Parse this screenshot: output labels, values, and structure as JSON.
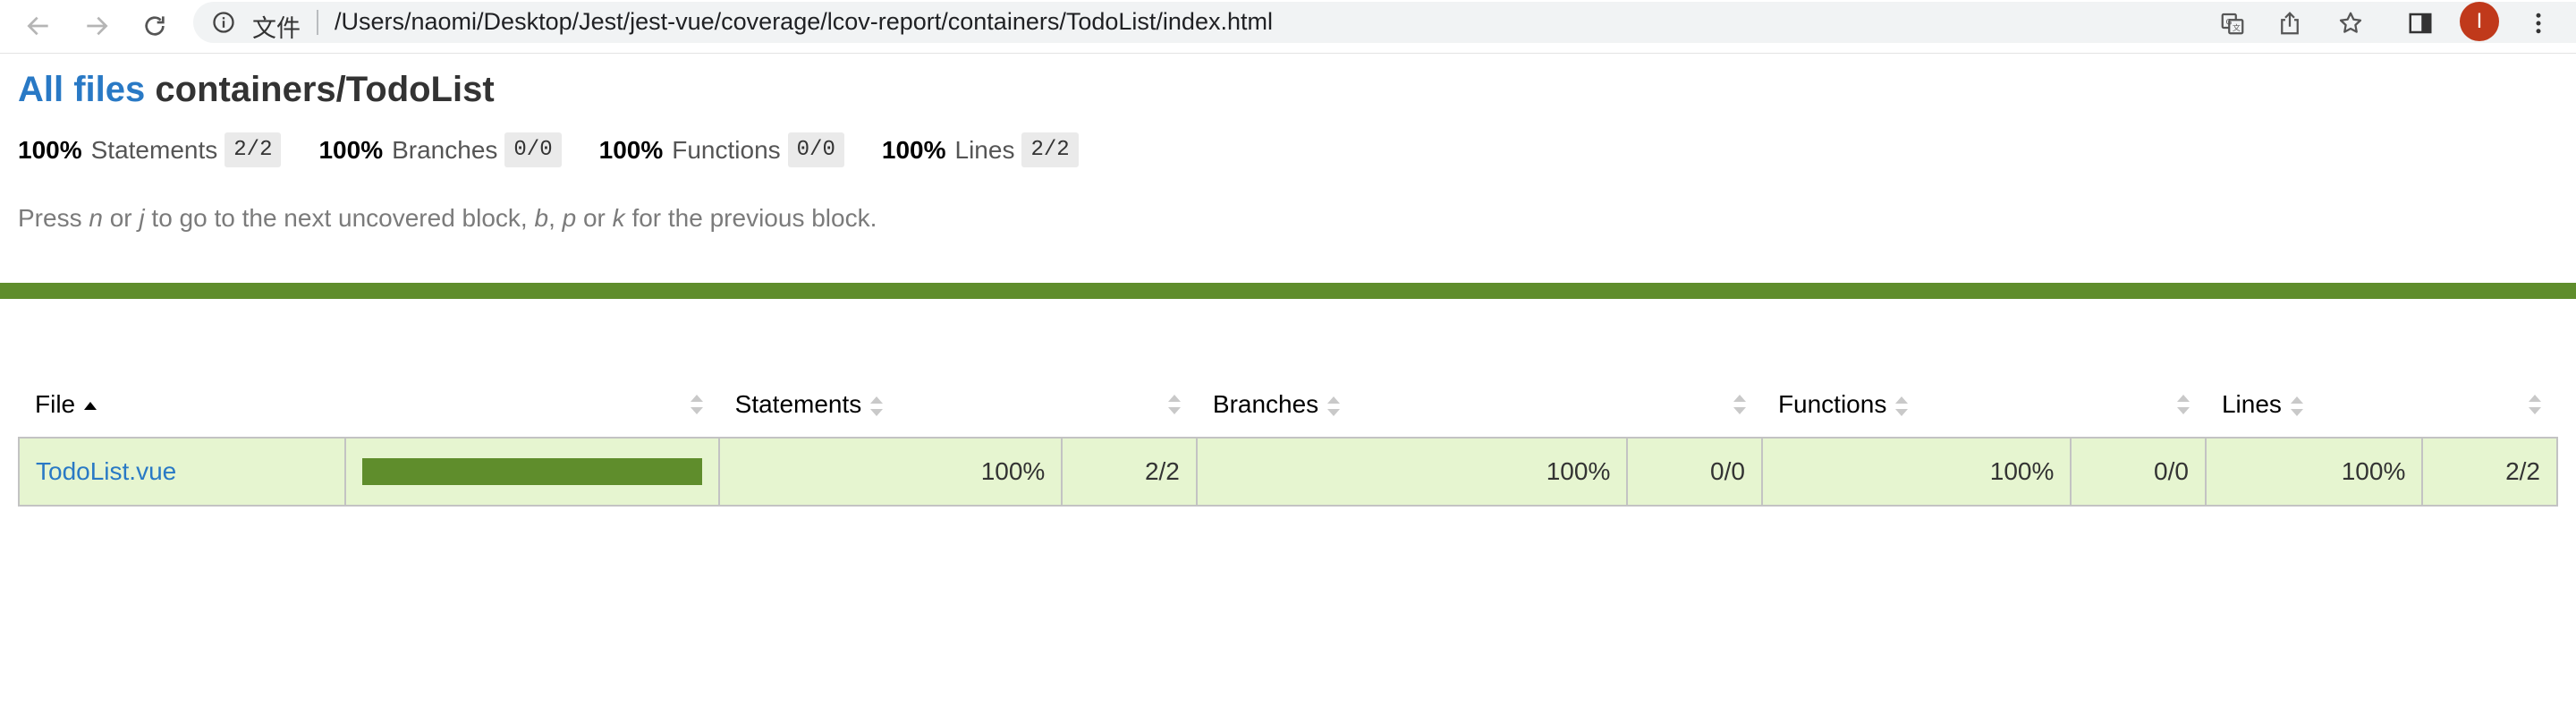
{
  "browser": {
    "info_label": "文件",
    "url": "/Users/naomi/Desktop/Jest/jest-vue/coverage/lcov-report/containers/TodoList/index.html",
    "profile_initial": "I",
    "icons": [
      "back-icon",
      "forward-icon",
      "reload-icon",
      "info-icon",
      "translate-icon",
      "share-icon",
      "star-icon",
      "sidebar-icon",
      "menu-icon"
    ]
  },
  "page": {
    "breadcrumb_root": "All files",
    "title": "containers/TodoList",
    "summary": [
      {
        "pct": "100%",
        "name": "Statements",
        "fraction": "2/2"
      },
      {
        "pct": "100%",
        "name": "Branches",
        "fraction": "0/0"
      },
      {
        "pct": "100%",
        "name": "Functions",
        "fraction": "0/0"
      },
      {
        "pct": "100%",
        "name": "Lines",
        "fraction": "2/2"
      }
    ],
    "hint": {
      "p1": "Press ",
      "k1": "n",
      "p2": " or ",
      "k2": "j",
      "p3": " to go to the next uncovered block, ",
      "k3": "b",
      "p4": ", ",
      "k4": "p",
      "p5": " or ",
      "k5": "k",
      "p6": " for the previous block."
    },
    "status_color": "#5f8d2c",
    "table": {
      "headers": {
        "file": "File",
        "statements": "Statements",
        "branches": "Branches",
        "functions": "Functions",
        "lines": "Lines"
      },
      "rows": [
        {
          "file": "TodoList.vue",
          "coverage_fraction": 1.0,
          "statements_pct": "100%",
          "statements_fraction": "2/2",
          "branches_pct": "100%",
          "branches_fraction": "0/0",
          "functions_pct": "100%",
          "functions_fraction": "0/0",
          "lines_pct": "100%",
          "lines_fraction": "2/2"
        }
      ]
    }
  }
}
